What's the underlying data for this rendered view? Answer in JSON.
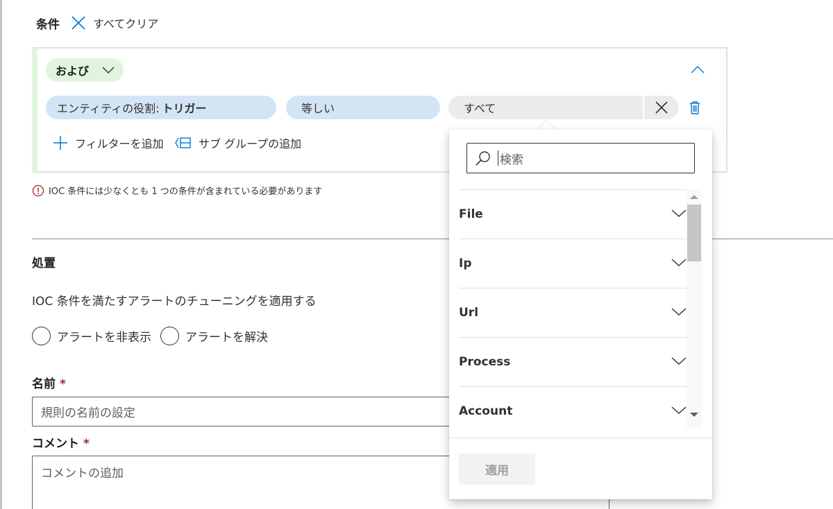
{
  "conditions": {
    "title": "条件",
    "clear_all_label": "すべてクリア"
  },
  "group": {
    "operator_label": "および",
    "filter": {
      "role_prefix": "エンティティの役割:",
      "role_value": "トリガー",
      "operator": "等しい",
      "value": "すべて"
    },
    "add_filter_label": "フィルターを追加",
    "add_subgroup_label": "サブ グループの追加"
  },
  "validation_error": "IOC 条件には少なくとも 1 つの条件が含まれている必要があります",
  "disposition": {
    "title": "処置",
    "description": "IOC 条件を満たすアラートのチューニングを適用する",
    "options": [
      {
        "label": "アラートを非表示"
      },
      {
        "label": "アラートを解決"
      }
    ]
  },
  "name_field": {
    "label": "名前",
    "required_mark": "*",
    "placeholder": "規則の名前の設定"
  },
  "comment_field": {
    "label": "コメント",
    "required_mark": "*",
    "placeholder": "コメントの追加"
  },
  "dropdown": {
    "search_placeholder": "検索",
    "items": [
      {
        "label": "File"
      },
      {
        "label": "Ip"
      },
      {
        "label": "Url"
      },
      {
        "label": "Process"
      },
      {
        "label": "Account"
      }
    ],
    "apply_label": "適用"
  },
  "colors": {
    "accent": "#0078d4",
    "and_pill": "#dff6dd",
    "filter_pill": "#d3e5f5",
    "value_pill": "#edebe9",
    "error": "#a4262c"
  },
  "icons": {
    "clear": "close-icon",
    "collapse": "chevron-up-icon",
    "delete": "trash-icon",
    "add": "plus-icon",
    "subgroup": "subgroup-icon",
    "search": "search-icon",
    "error": "error-circle-icon"
  }
}
